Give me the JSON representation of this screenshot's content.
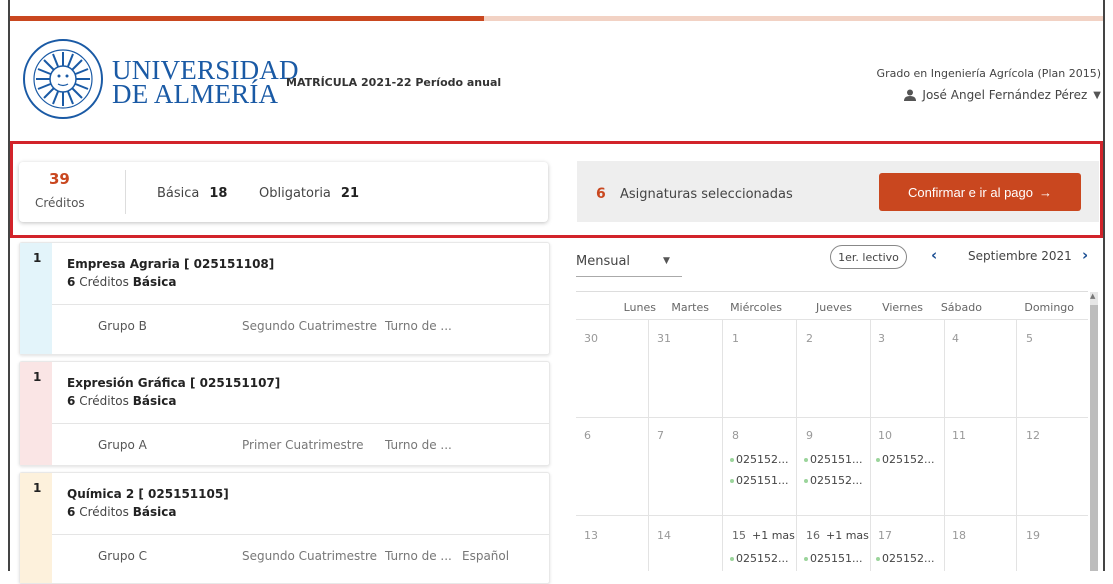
{
  "header": {
    "university_line1": "UNIVERSIDAD",
    "university_line2": "DE ALMERÍA",
    "matricula": "MATRÍCULA 2021-22 Período anual",
    "grado": "Grado en Ingeniería Agrícola (Plan 2015)",
    "user": "José Angel Fernández Pérez"
  },
  "summary": {
    "credits": "39",
    "credits_label": "Créditos",
    "basica_label": "Básica",
    "basica_value": "18",
    "obligatoria_label": "Obligatoria",
    "obligatoria_value": "21"
  },
  "selection": {
    "count": "6",
    "label": "Asignaturas seleccionadas",
    "confirm_label": "Confirmar e ir al pago",
    "confirm_arrow": "→"
  },
  "courses": [
    {
      "num": "1",
      "title": "Empresa Agraria [ 025151108]",
      "credits": "6",
      "credits_word": "Créditos",
      "type": "Básica",
      "group": "Grupo B",
      "semester": "Segundo Cuatrimestre",
      "turno": "Turno de ...",
      "lang": "",
      "color": "#e3f4fa"
    },
    {
      "num": "1",
      "title": "Expresión Gráfica [ 025151107]",
      "credits": "6",
      "credits_word": "Créditos",
      "type": "Básica",
      "group": "Grupo A",
      "semester": "Primer Cuatrimestre",
      "turno": "Turno de ...",
      "lang": "",
      "color": "#fae5e5"
    },
    {
      "num": "1",
      "title": "Química 2 [ 025151105]",
      "credits": "6",
      "credits_word": "Créditos",
      "type": "Básica",
      "group": "Grupo C",
      "semester": "Segundo Cuatrimestre",
      "turno": "Turno de ...",
      "lang": "Español",
      "color": "#fdf1dc"
    }
  ],
  "calendar": {
    "mode": "Mensual",
    "lectivo": "1er. lectivo",
    "month": "Septiembre 2021",
    "days_of_week": [
      "Lunes",
      "Martes",
      "Miércoles",
      "Jueves",
      "Viernes",
      "Sábado",
      "Domingo"
    ],
    "week1": [
      "30",
      "31",
      "1",
      "2",
      "3",
      "4",
      "5"
    ],
    "week2": [
      "6",
      "7",
      "8",
      "9",
      "10",
      "11",
      "12"
    ],
    "week3": [
      "13",
      "14",
      "15",
      "16",
      "17",
      "18",
      "19"
    ],
    "more_wed": "+1 mas",
    "more_thu": "+1 mas",
    "events_w2": {
      "wed": [
        "025152...",
        "025151..."
      ],
      "thu": [
        "025151...",
        "025152..."
      ],
      "fri": [
        "025152..."
      ]
    },
    "events_w3": {
      "wed": "025152...",
      "thu": "025151...",
      "fri": "025152..."
    }
  }
}
